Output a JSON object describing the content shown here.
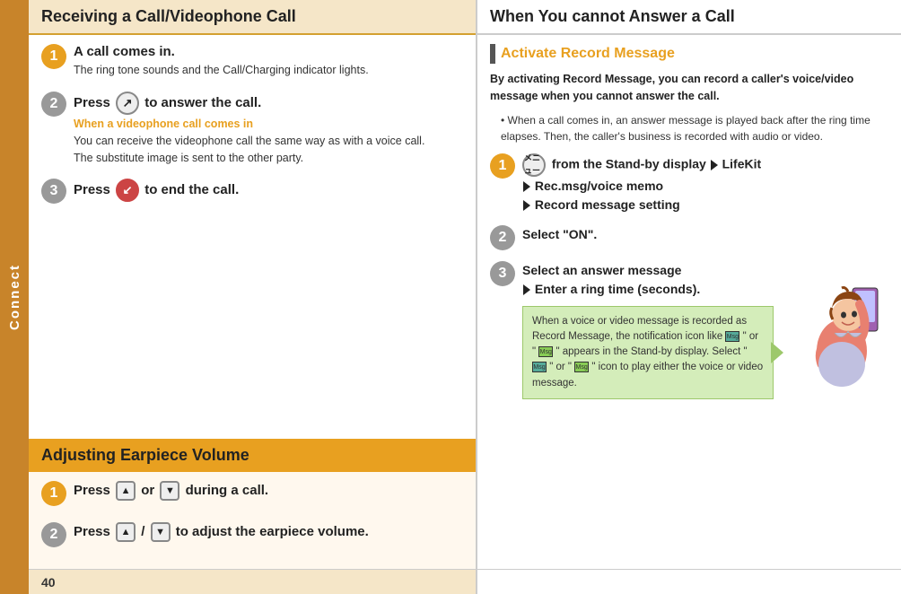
{
  "sidebar": {
    "label": "Connect"
  },
  "left_column": {
    "section1": {
      "header": "Receiving a Call/Videophone Call",
      "steps": [
        {
          "number": "1",
          "title": "A call comes in.",
          "body": "The ring tone sounds and the Call/Charging indicator lights."
        },
        {
          "number": "2",
          "title_prefix": "Press ",
          "title_suffix": " to answer the call.",
          "videophone_label": "When a videophone call comes in",
          "videophone_body1": "You can receive the videophone call the same way as with a voice call.",
          "videophone_body2": "The substitute image is sent to the other party."
        },
        {
          "number": "3",
          "title_prefix": "Press ",
          "title_suffix": " to end the call."
        }
      ]
    },
    "section2": {
      "header": "Adjusting Earpiece Volume",
      "steps": [
        {
          "number": "1",
          "title_prefix": "Press ",
          "or_text": "or",
          "title_suffix": " during a call."
        },
        {
          "number": "2",
          "title_prefix": "Press ",
          "title_middle": "/",
          "title_suffix": " to adjust the earpiece volume."
        }
      ]
    }
  },
  "right_column": {
    "header": "When You cannot Answer a Call",
    "activate_section": {
      "title": "Activate Record Message",
      "intro": "By activating Record Message, you can record a caller's voice/video message when you cannot answer the call.",
      "bullet": "When a call comes in, an answer message is played back after the ring time elapses. Then, the caller's business is recorded with audio or video.",
      "steps": [
        {
          "number": "1",
          "text1": " from the Stand-by display",
          "arrow1": "▶",
          "text2": "LifeKit",
          "arrow2": "▶",
          "text3": "Rec.msg/voice memo",
          "arrow3": "▶",
          "text4": "Record message setting"
        },
        {
          "number": "2",
          "text": "Select \"ON\"."
        },
        {
          "number": "3",
          "text1": "Select an answer message",
          "arrow": "▶",
          "text2": "Enter a ring time (seconds)."
        }
      ],
      "info_box": {
        "text": "When a voice or video message is recorded as Record Message, the notification icon like \"",
        "text2": "\" or \"",
        "text3": "\" appears in the Stand-by display. Select \"",
        "text4": "\" or \"",
        "text5": "\" icon to play either the voice or video message."
      }
    }
  },
  "footer": {
    "page_number": "40"
  }
}
